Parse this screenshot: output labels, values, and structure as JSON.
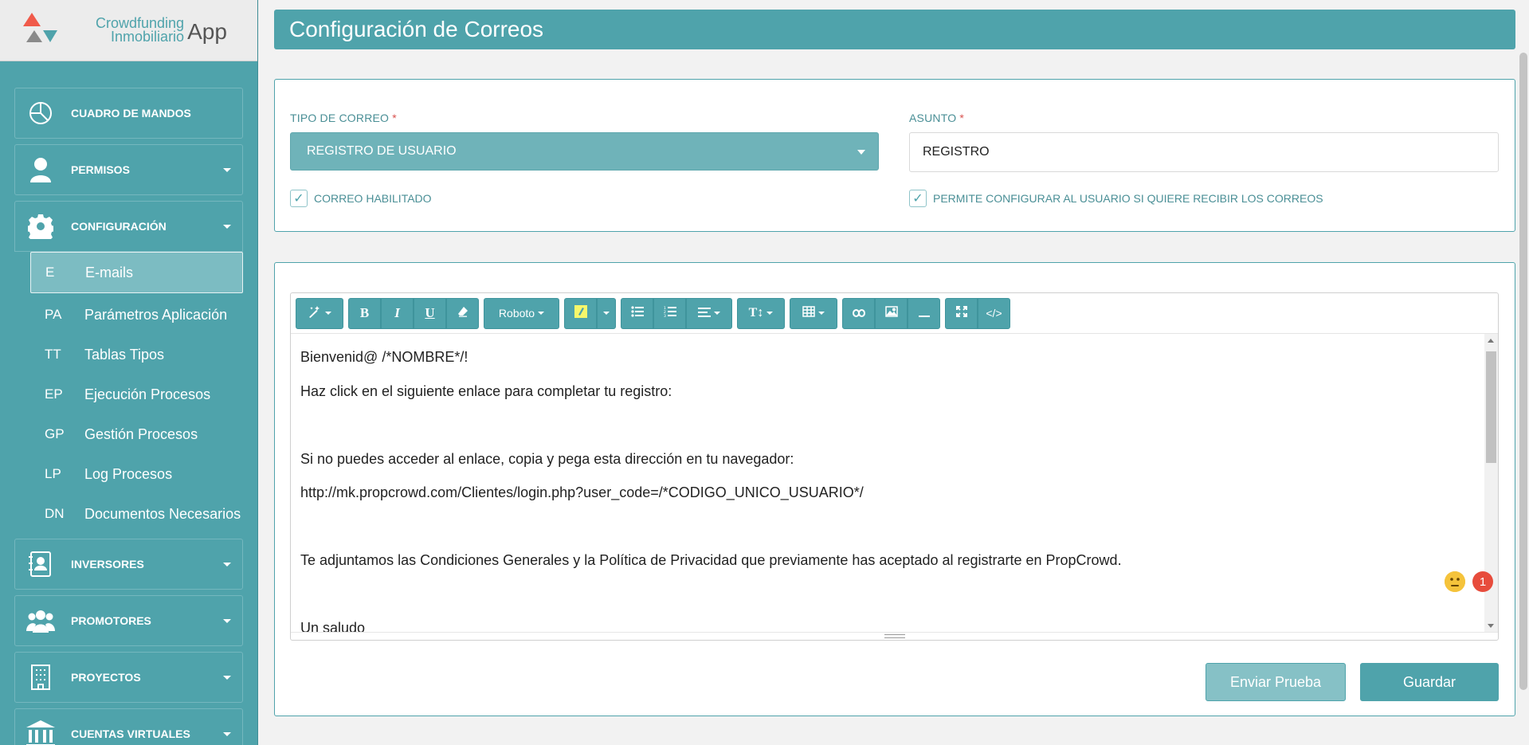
{
  "brand": {
    "line1": "Crowdfunding",
    "line2": "Inmobiliario",
    "app": "App",
    "colors": {
      "primary": "#4fa3ab",
      "logo_red": "#f05a4a",
      "logo_gray": "#8a8a8a",
      "logo_teal": "#4fa3ab"
    }
  },
  "sidebar": {
    "items": [
      {
        "label": "CUADRO DE MANDOS",
        "icon": "pie-chart-icon"
      },
      {
        "label": "PERMISOS",
        "icon": "user-icon"
      },
      {
        "label": "CONFIGURACIÓN",
        "icon": "gear-icon"
      },
      {
        "label": "INVERSORES",
        "icon": "contact-book-icon"
      },
      {
        "label": "PROMOTORES",
        "icon": "users-group-icon"
      },
      {
        "label": "PROYECTOS",
        "icon": "building-icon"
      },
      {
        "label": "CUENTAS VIRTUALES",
        "icon": "bank-icon"
      }
    ],
    "submenu": [
      {
        "abbr": "E",
        "label": "E-mails"
      },
      {
        "abbr": "PA",
        "label": "Parámetros Aplicación"
      },
      {
        "abbr": "TT",
        "label": "Tablas Tipos"
      },
      {
        "abbr": "EP",
        "label": "Ejecución Procesos"
      },
      {
        "abbr": "GP",
        "label": "Gestión Procesos"
      },
      {
        "abbr": "LP",
        "label": "Log Procesos"
      },
      {
        "abbr": "DN",
        "label": "Documentos Necesarios"
      }
    ]
  },
  "page": {
    "title": "Configuración de Correos"
  },
  "form": {
    "tipo_label": "TIPO DE CORREO",
    "tipo_value": "REGISTRO DE USUARIO",
    "asunto_label": "ASUNTO",
    "asunto_value": "REGISTRO",
    "required_mark": "*",
    "check_enabled": "CORREO HABILITADO",
    "check_user_config": "PERMITE CONFIGURAR AL USUARIO SI QUIERE RECIBIR LOS CORREOS"
  },
  "toolbar": {
    "font": "Roboto"
  },
  "editor": {
    "lines": [
      "Bienvenid@ /*NOMBRE*/!",
      "Haz click en el siguiente enlace para completar tu registro:",
      "",
      "Si no puedes acceder al enlace, copia y pega esta dirección en tu navegador:",
      "http://mk.propcrowd.com/Clientes/login.php?user_code=/*CODIGO_UNICO_USUARIO*/",
      "",
      "Te adjuntamos las Condiciones Generales y la Política de Privacidad que previamente has aceptado al registrarte en PropCrowd.",
      "",
      "Un saludo"
    ],
    "badge_count": "1"
  },
  "actions": {
    "test": "Enviar Prueba",
    "save": "Guardar"
  }
}
